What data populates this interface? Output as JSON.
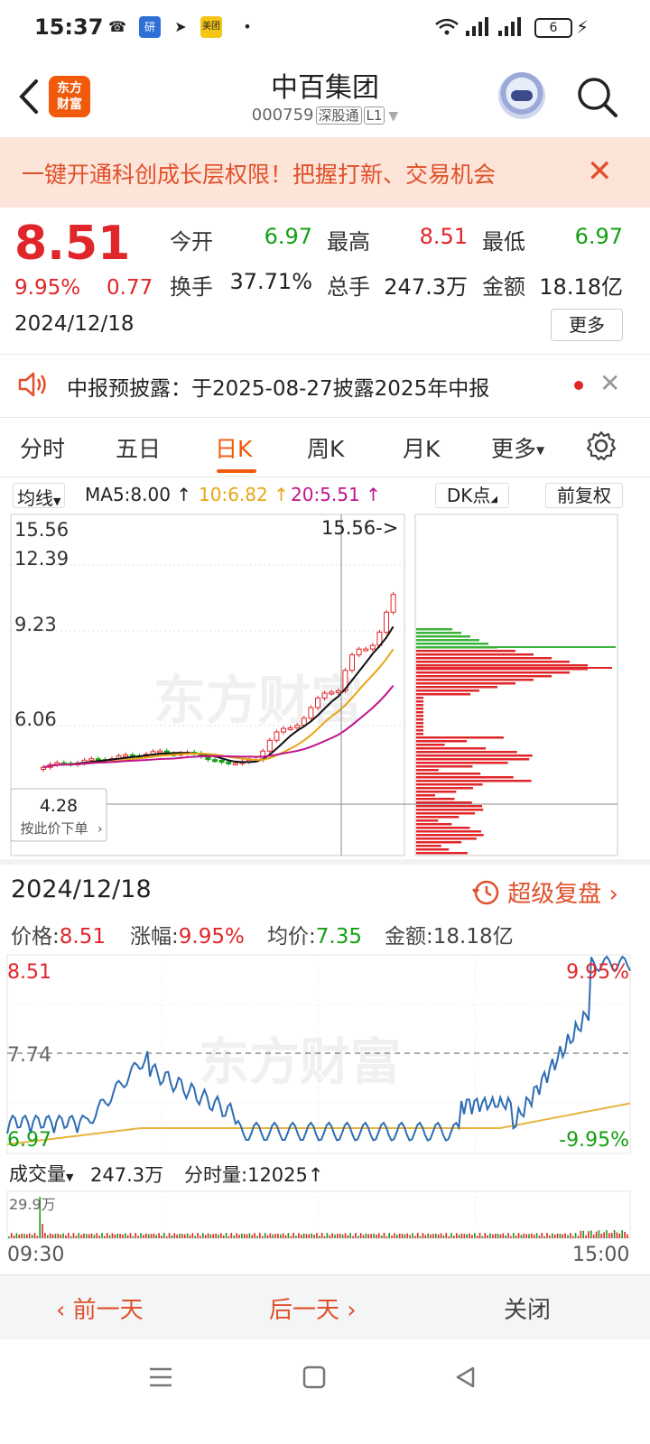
{
  "status_bar": {
    "time": "15:37",
    "battery": "6"
  },
  "header": {
    "logo_text": "东方财富",
    "stock_name": "中百集团",
    "stock_code": "000759",
    "tag_market": "深股通",
    "tag_level": "L1"
  },
  "banner": {
    "text": "一键开通科创成长层权限！把握打新、交易机会"
  },
  "quote": {
    "price": "8.51",
    "change_pct": "9.95%",
    "change_amt": "0.77",
    "date": "2024/12/18",
    "open_label": "今开",
    "open": "6.97",
    "high_label": "最高",
    "high": "8.51",
    "low_label": "最低",
    "low": "6.97",
    "turnover_label": "换手",
    "turnover": "37.71%",
    "volume_label": "总手",
    "volume": "247.3万",
    "amount_label": "金额",
    "amount": "18.18亿",
    "more_label": "更多"
  },
  "notice": {
    "text": "中报预披露：于2025-08-27披露2025年中报"
  },
  "tabs": [
    {
      "label": "分时"
    },
    {
      "label": "五日"
    },
    {
      "label": "日K"
    },
    {
      "label": "周K"
    },
    {
      "label": "月K"
    },
    {
      "label": "更多"
    }
  ],
  "ma": {
    "select_label": "均线",
    "ma5": "MA5:8.00",
    "ma10": "10:6.82",
    "ma20": "20:5.51",
    "dk_label": "DK点",
    "fq_label": "前复权"
  },
  "kline": {
    "y_labels": [
      "15.56",
      "12.39",
      "9.23",
      "6.06"
    ],
    "max_marker": "15.56->",
    "crosshair_price": "4.28",
    "crosshair_hint": "按此价下单",
    "watermark": "东方财富"
  },
  "intraday": {
    "date": "2024/12/18",
    "replay_label": "超级复盘",
    "price_label": "价格:",
    "price": "8.51",
    "chg_label": "涨幅:",
    "chg": "9.95%",
    "avg_label": "均价:",
    "avg": "7.35",
    "amt_label": "金额:",
    "amt": "18.18亿",
    "y_top": "8.51",
    "y_mid": "7.74",
    "y_bot": "6.97",
    "pct_top": "9.95%",
    "pct_bot": "-9.95%",
    "vol_select": "成交量",
    "vol_total": "247.3万",
    "vol_tick_label": "分时量:",
    "vol_tick": "12025",
    "vol_max": "29.9万",
    "time_start": "09:30",
    "time_end": "15:00",
    "watermark": "东方财富"
  },
  "bottom_nav": {
    "prev": "前一天",
    "next": "后一天",
    "close": "关闭"
  },
  "colors": {
    "up": "#e0262a",
    "down": "#14a014",
    "accent": "#f05a0a",
    "ma10": "#e6a514",
    "ma20": "#c0148c",
    "intraday_line": "#2e6db4",
    "avg_line": "#e6b43c"
  }
}
